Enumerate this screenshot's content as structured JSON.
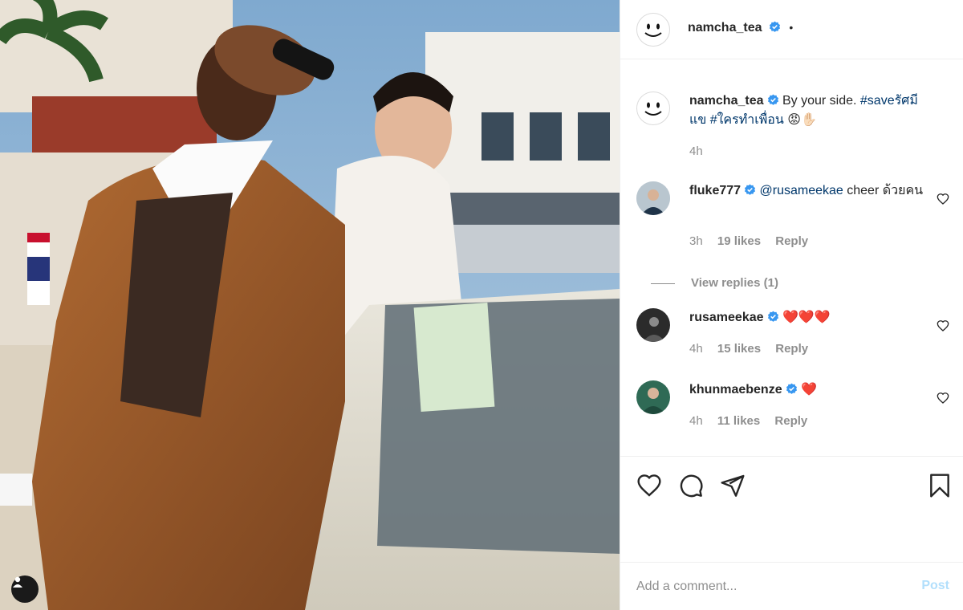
{
  "post": {
    "author": "namcha_tea",
    "separator": "•"
  },
  "caption": {
    "username": "namcha_tea",
    "text": "By your side.",
    "hashtag1": "#saveรัศมีแข",
    "hashtag2": "#ใครทำเพื่อน",
    "emoji": "😡✋🏻",
    "timestamp": "4h"
  },
  "comments": [
    {
      "username": "fluke777",
      "mention": "@rusameekae",
      "text": "cheer ด้วยคน",
      "timestamp": "3h",
      "likes": "19 likes",
      "reply_label": "Reply"
    },
    {
      "username": "rusameekae",
      "text": "❤️❤️❤️",
      "timestamp": "4h",
      "likes": "15 likes",
      "reply_label": "Reply"
    },
    {
      "username": "khunmaebenze",
      "text": "❤️",
      "timestamp": "4h",
      "likes": "11 likes",
      "reply_label": "Reply"
    }
  ],
  "view_replies": "View replies (1)",
  "icons": {
    "like": "heart-icon",
    "comment": "comment-icon",
    "share": "paper-plane-icon",
    "save": "bookmark-icon",
    "verified": "verified-badge-icon",
    "tag": "person-tag-icon"
  },
  "colors": {
    "verified": "#3897f0",
    "link": "#00376b",
    "muted": "#8e8e8e",
    "post_disabled": "#b2dffc"
  },
  "add_comment": {
    "placeholder": "Add a comment...",
    "post_label": "Post"
  }
}
